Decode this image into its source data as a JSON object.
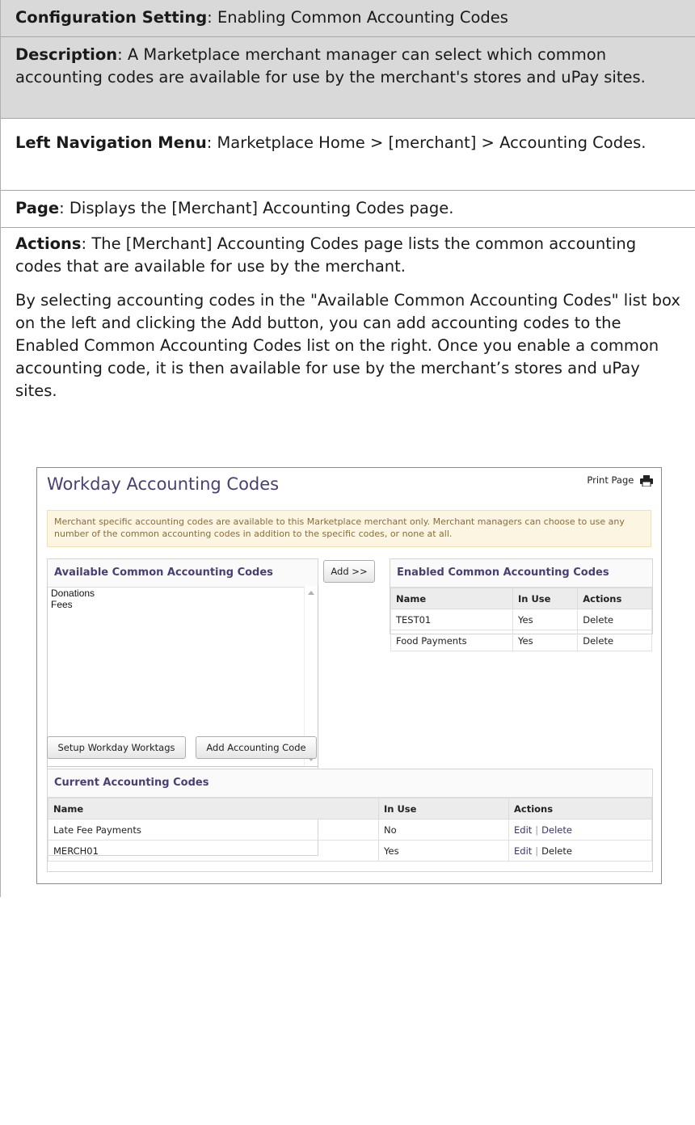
{
  "doc": {
    "config": {
      "label": "Configuration Setting",
      "text": ": Enabling Common Accounting Codes"
    },
    "description": {
      "label": "Description",
      "text": ": A Marketplace merchant manager can select which common accounting codes are available for use by the merchant's stores and uPay sites."
    },
    "leftnav": {
      "label": "Left Navigation Menu",
      "text": ": Marketplace Home > [merchant] > Accounting Codes."
    },
    "page": {
      "label": "Page",
      "text": ": Displays the [Merchant] Accounting Codes page."
    },
    "actions": {
      "label": "Actions",
      "text": ": The [Merchant] Accounting Codes page lists the common accounting codes that are available for use by the merchant.",
      "para2": "By selecting accounting codes in the \"Available Common Accounting Codes\" list box on the left and clicking the Add button, you can add accounting codes to the Enabled Common Accounting Codes list on the right. Once you enable a common accounting code, it is then available for use by the merchant’s stores and uPay sites."
    }
  },
  "screenshot": {
    "title": "Workday Accounting Codes",
    "print_label": "Print Page",
    "notice": "Merchant specific accounting codes are available to this Marketplace merchant only. Merchant managers can choose to use any number of the common accounting codes in addition to the specific codes, or none at all.",
    "available": {
      "heading": "Available Common Accounting Codes",
      "items": [
        "Donations",
        "Fees"
      ]
    },
    "add_button": "Add >>",
    "enabled": {
      "heading": "Enabled Common Accounting Codes",
      "columns": [
        "Name",
        "In Use",
        "Actions"
      ],
      "rows": [
        {
          "name": "TEST01",
          "in_use": "Yes",
          "action": "Delete"
        },
        {
          "name": "Food Payments",
          "in_use": "Yes",
          "action": "Delete"
        }
      ]
    },
    "setup_button": "Setup Workday Worktags",
    "add_code_button": "Add Accounting Code",
    "current": {
      "heading": "Current Accounting Codes",
      "columns": [
        "Name",
        "In Use",
        "Actions"
      ],
      "rows": [
        {
          "name": "Late Fee Payments",
          "in_use": "No",
          "edit": "Edit",
          "sep": "|",
          "delete": "Delete"
        },
        {
          "name": "MERCH01",
          "in_use": "Yes",
          "edit": "Edit",
          "sep": "|",
          "delete": "Delete"
        }
      ]
    }
  }
}
